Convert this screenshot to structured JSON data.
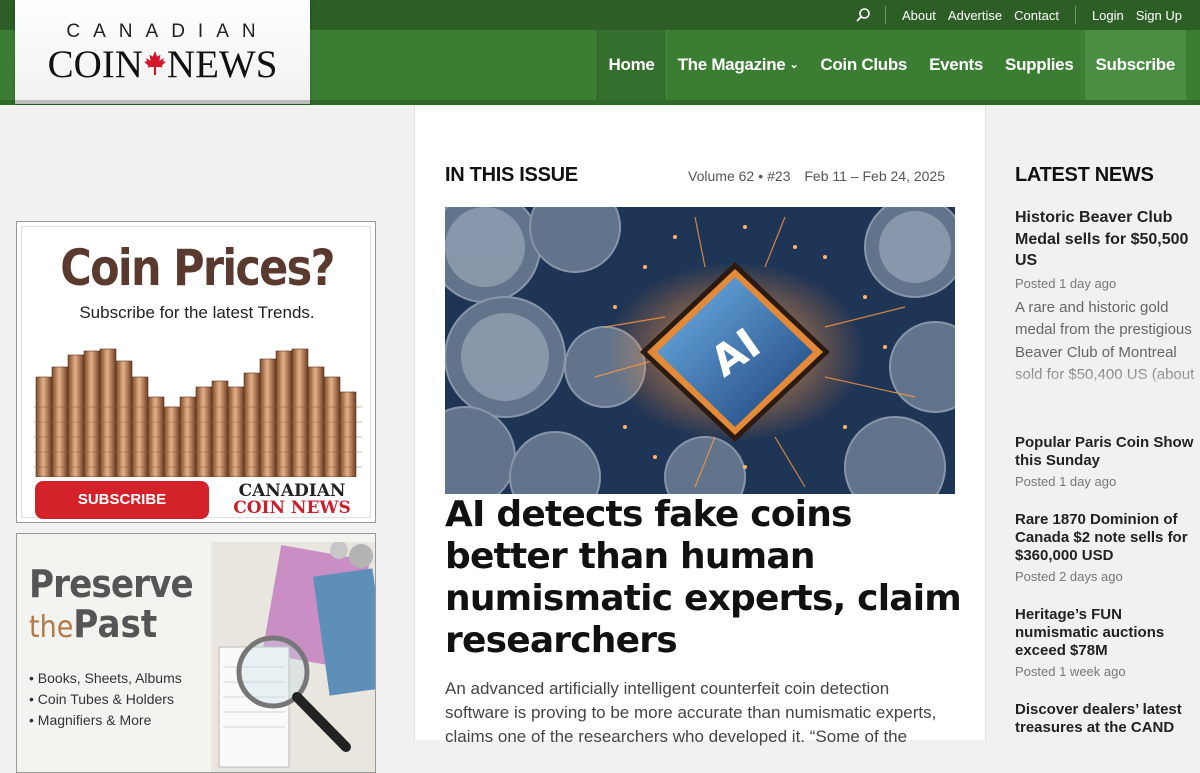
{
  "header": {
    "logo_top": "CANADIAN",
    "logo_left": "COIN",
    "logo_right": "NEWS",
    "top_links": [
      "About",
      "Advertise",
      "Contact"
    ],
    "account_links": [
      "Login",
      "Sign Up"
    ],
    "nav": [
      {
        "label": "Home"
      },
      {
        "label": "The Magazine"
      },
      {
        "label": "Coin Clubs"
      },
      {
        "label": "Events"
      },
      {
        "label": "Supplies"
      },
      {
        "label": "Subscribe"
      }
    ],
    "colors": {
      "topbar": "#2d5e26",
      "navbar": "#3a7d33",
      "accent_red": "#d3162a"
    }
  },
  "ads": {
    "coin_prices": {
      "headline": "Coin Prices?",
      "subline": "Subscribe for the latest Trends.",
      "button": "SUBSCRIBE",
      "brand_top": "CANADIAN",
      "brand_bottom": "COIN NEWS"
    },
    "preserve": {
      "line1": "Preserve",
      "line2_small": "the",
      "line2_big": "Past",
      "bullets": [
        "• Books, Sheets, Albums",
        "• Coin Tubes & Holders",
        "• Magnifiers & More"
      ]
    }
  },
  "issue": {
    "heading": "IN THIS ISSUE",
    "volume": "Volume 62",
    "number": "#23",
    "dates": "Feb 11 – Feb 24, 2025",
    "chip_text": "AI",
    "headline": "AI detects fake coins better than human numismatic experts, claim researchers",
    "excerpt": "An advanced artificially intelligent counterfeit coin detection software is proving to be more accurate than numismatic experts, claims one of the researchers who developed it. “Some of the"
  },
  "latest": {
    "heading": "LATEST NEWS",
    "items": [
      {
        "title": "Historic Beaver Club Medal sells for $50,500 US",
        "posted": "Posted 1 day ago",
        "excerpt": "A rare and historic gold medal from the prestigious Beaver Club of Montreal sold for $50,400 US (about"
      },
      {
        "title": "Popular Paris Coin Show this Sunday",
        "posted": "Posted 1 day ago"
      },
      {
        "title": "Rare 1870 Dominion of Canada $2 note sells for $360,000 USD",
        "posted": "Posted 2 days ago"
      },
      {
        "title": "Heritage’s FUN numismatic auctions exceed $78M",
        "posted": "Posted 1 week ago"
      },
      {
        "title": "Discover dealers’ latest treasures at the CAND",
        "posted": ""
      }
    ]
  }
}
